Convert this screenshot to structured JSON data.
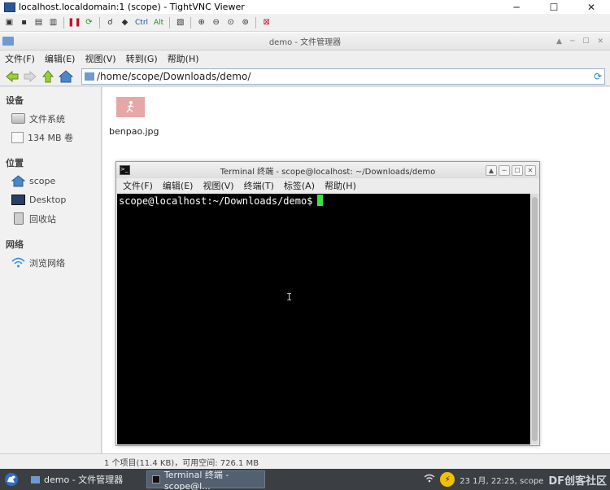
{
  "vnc": {
    "title": "localhost.localdomain:1 (scope) - TightVNC Viewer",
    "ctrl_label": "Ctrl",
    "alt_label": "Alt"
  },
  "fm": {
    "title": "demo - 文件管理器",
    "menu": [
      "文件(F)",
      "编辑(E)",
      "视图(V)",
      "转到(G)",
      "帮助(H)"
    ],
    "path": "/home/scope/Downloads/demo/",
    "sidebar": {
      "devices_header": "设备",
      "devices": [
        "文件系统",
        "134 MB 卷"
      ],
      "places_header": "位置",
      "places": [
        "scope",
        "Desktop",
        "回收站"
      ],
      "network_header": "网络",
      "network": [
        "浏览网络"
      ]
    },
    "file_name": "benpao.jpg",
    "status": "1 个项目(11.4 KB)，可用空间: 726.1 MB"
  },
  "terminal": {
    "title": "Terminal 终端 - scope@localhost: ~/Downloads/demo",
    "menu": [
      "文件(F)",
      "编辑(E)",
      "视图(V)",
      "终端(T)",
      "标签(A)",
      "帮助(H)"
    ],
    "prompt": "scope@localhost:~/Downloads/demo$"
  },
  "taskbar": {
    "items": [
      "demo - 文件管理器",
      "Terminal 终端 - scope@l..."
    ],
    "clock": "23 1月, 22:25, scope",
    "watermark": "DF创客社区"
  }
}
